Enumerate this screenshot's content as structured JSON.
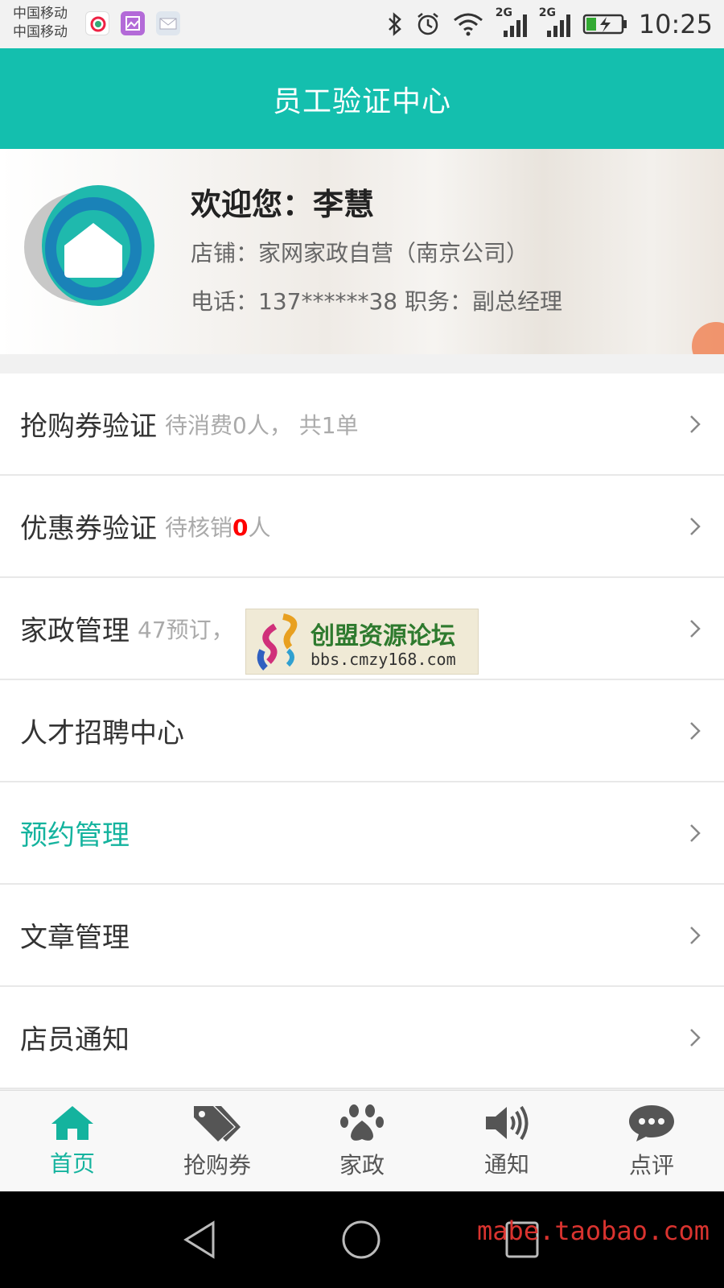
{
  "status_bar": {
    "carrier1": "中国移动",
    "carrier2": "中国移动",
    "signal1_label": "2G",
    "signal2_label": "2G",
    "time": "10:25"
  },
  "header": {
    "title": "员工验证中心"
  },
  "profile": {
    "welcome": "欢迎您：李慧",
    "shop": "店铺：家网家政自营（南京公司）",
    "phone_line": "电话：137******38   职务：副总经理"
  },
  "menu": {
    "items": [
      {
        "label": "抢购券验证",
        "sub": "待消费0人， 共1单"
      },
      {
        "label": "优惠券验证",
        "sub_prefix": "待核销",
        "sub_count": "0",
        "sub_suffix": "人"
      },
      {
        "label": "家政管理",
        "sub": "47预订，"
      },
      {
        "label": "人才招聘中心"
      },
      {
        "label": "预约管理"
      },
      {
        "label": "文章管理"
      },
      {
        "label": "店员通知"
      }
    ]
  },
  "ad": {
    "title": "创盟资源论坛",
    "url": "bbs.cmzy168.com"
  },
  "tabbar": {
    "tabs": [
      {
        "label": "首页",
        "icon": "home-icon"
      },
      {
        "label": "抢购券",
        "icon": "tag-icon"
      },
      {
        "label": "家政",
        "icon": "paw-icon"
      },
      {
        "label": "通知",
        "icon": "speaker-icon"
      },
      {
        "label": "点评",
        "icon": "chat-icon"
      }
    ]
  },
  "watermark": "mabe.taobao.com",
  "colors": {
    "accent": "#14bfae",
    "active_text": "#14b39e",
    "highlight_red": "#ff0000"
  }
}
